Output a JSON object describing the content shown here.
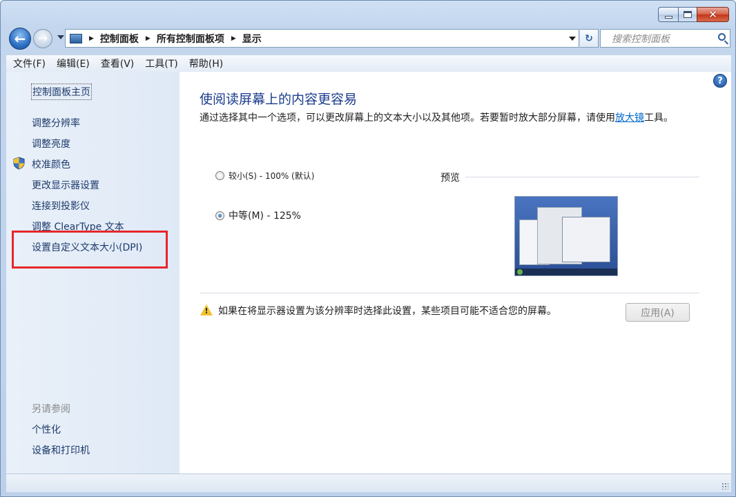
{
  "window": {
    "caption": {
      "close_glyph": "✕"
    }
  },
  "nav": {
    "back_glyph": "←",
    "forward_glyph": "→",
    "breadcrumb": [
      "控制面板",
      "所有控制面板项",
      "显示"
    ],
    "search_placeholder": "搜索控制面板",
    "refresh_glyph": "↻"
  },
  "menubar": {
    "items": [
      "文件(F)",
      "编辑(E)",
      "查看(V)",
      "工具(T)",
      "帮助(H)"
    ]
  },
  "sidebar": {
    "home": "控制面板主页",
    "links": [
      "调整分辨率",
      "调整亮度",
      "校准颜色",
      "更改显示器设置",
      "连接到投影仪",
      "调整 ClearType 文本",
      "设置自定义文本大小(DPI)"
    ],
    "see_also_title": "另请参阅",
    "see_also_links": [
      "个性化",
      "设备和打印机"
    ],
    "highlight_color": "#e8262b"
  },
  "main": {
    "help_glyph": "?",
    "title": "使阅读屏幕上的内容更容易",
    "desc_before": "通过选择其中一个选项，可以更改屏幕上的文本大小以及其他项。若要暂时放大部分屏幕，请使用",
    "desc_link": "放大镜",
    "desc_after": "工具。",
    "options": [
      {
        "label": "较小(S) - 100% (默认)",
        "checked": false
      },
      {
        "label": "中等(M) - 125%",
        "checked": true
      }
    ],
    "preview_label": "预览",
    "warning_glyph": "!",
    "warning_text": "如果在将显示器设置为该分辨率时选择此设置，某些项目可能不适合您的屏幕。",
    "apply_label": "应用(A)"
  }
}
